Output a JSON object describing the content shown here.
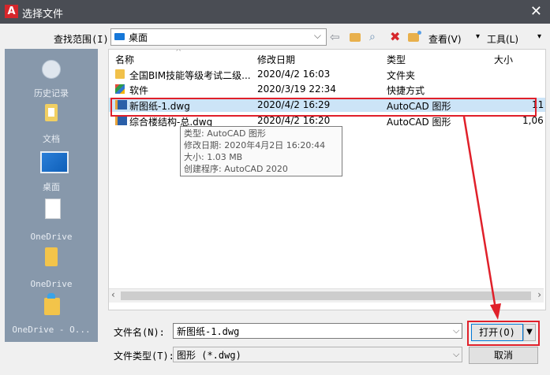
{
  "window": {
    "logo_letter": "A",
    "title": "选择文件",
    "close_glyph": "✕"
  },
  "toolbar": {
    "look_in_label": "查找范围(I):",
    "look_in_value": "桌面",
    "view_label": "查看(V)",
    "tools_label": "工具(L)"
  },
  "sidebar": {
    "items": [
      {
        "label": "历史记录"
      },
      {
        "label": "文档"
      },
      {
        "label": "桌面"
      },
      {
        "label": "OneDrive"
      },
      {
        "label": "OneDrive"
      },
      {
        "label": "OneDrive - O..."
      }
    ]
  },
  "filelist": {
    "columns": {
      "name": "名称",
      "modified": "修改日期",
      "type": "类型",
      "size": "大小"
    },
    "rows": [
      {
        "name": "全国BIM技能等级考试二级...",
        "modified": "2020/4/2 16:03",
        "type": "文件夹",
        "size": "",
        "icon": "folder-icon"
      },
      {
        "name": "软件",
        "modified": "2020/3/19 22:34",
        "type": "快捷方式",
        "size": "",
        "icon": "shortcut-icon"
      },
      {
        "name": "新图纸-1.dwg",
        "modified": "2020/4/2 16:29",
        "type": "AutoCAD 图形",
        "size": "11",
        "icon": "dwg-icon",
        "selected": true
      },
      {
        "name": "综合楼结构-总.dwg",
        "modified": "2020/4/2 16:20",
        "type": "AutoCAD 图形",
        "size": "1,06",
        "icon": "dwg-icon"
      }
    ]
  },
  "tooltip": {
    "type": "类型: AutoCAD 图形",
    "modified": "修改日期: 2020年4月2日 16:20:44",
    "size": "大小: 1.03 MB",
    "app": "创建程序: AutoCAD 2020"
  },
  "footer": {
    "filename_label": "文件名(N):",
    "filename_value": "新图纸-1.dwg",
    "filetype_label": "文件类型(T):",
    "filetype_value": "图形 (*.dwg)",
    "open_label": "打开(O)",
    "cancel_label": "取消"
  },
  "colors": {
    "annotation_red": "#e0202a",
    "title_bar": "#4a4d54",
    "sidebar": "#8798ab",
    "selection": "#cce4f7"
  }
}
